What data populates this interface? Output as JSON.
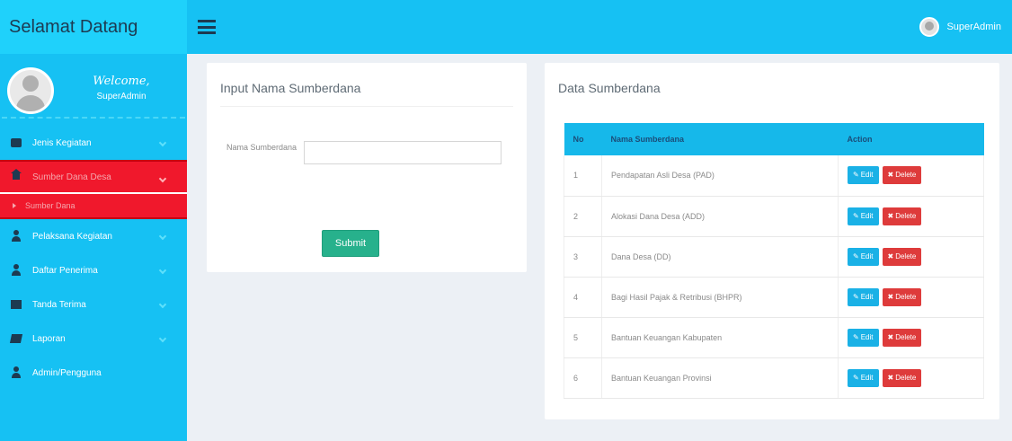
{
  "header": {
    "brand": "Selamat Datang",
    "user_label": "SuperAdmin"
  },
  "sidebar": {
    "welcome": "Welcome,",
    "profile_name": "SuperAdmin",
    "items": [
      {
        "label": "Jenis Kegiatan",
        "icon": "briefcase-icon"
      },
      {
        "label": "Sumber Dana Desa",
        "icon": "home-icon"
      },
      {
        "label": "Pelaksana Kegiatan",
        "icon": "user-icon"
      },
      {
        "label": "Daftar Penerima",
        "icon": "user-icon"
      },
      {
        "label": "Tanda Terima",
        "icon": "envelope-icon"
      },
      {
        "label": "Laporan",
        "icon": "book-icon"
      },
      {
        "label": "Admin/Pengguna",
        "icon": "user-icon"
      }
    ],
    "submenu": {
      "label": "Sumber Dana"
    }
  },
  "form_panel": {
    "title": "Input Nama Sumberdana",
    "label": "Nama Sumberdana",
    "input_value": "",
    "submit_label": "Submit"
  },
  "data_panel": {
    "title": "Data Sumberdana",
    "columns": [
      "No",
      "Nama Sumberdana",
      "Action"
    ],
    "rows": [
      {
        "no": "1",
        "name": "Pendapatan Asli Desa (PAD)"
      },
      {
        "no": "2",
        "name": "Alokasi Dana Desa (ADD)"
      },
      {
        "no": "3",
        "name": "Dana Desa (DD)"
      },
      {
        "no": "4",
        "name": "Bagi Hasil Pajak & Retribusi (BHPR)"
      },
      {
        "no": "5",
        "name": "Bantuan Keuangan Kabupaten"
      },
      {
        "no": "6",
        "name": "Bantuan Keuangan Provinsi"
      }
    ],
    "edit_label": "Edit",
    "delete_label": "Delete"
  },
  "colors": {
    "topbar": "#16c1f3",
    "brand_bg": "#1fd1fb",
    "active_menu": "#f0182c",
    "submit": "#27b18c",
    "edit": "#1ab1e6",
    "delete": "#de3b3b",
    "table_header": "#16b8ea"
  }
}
